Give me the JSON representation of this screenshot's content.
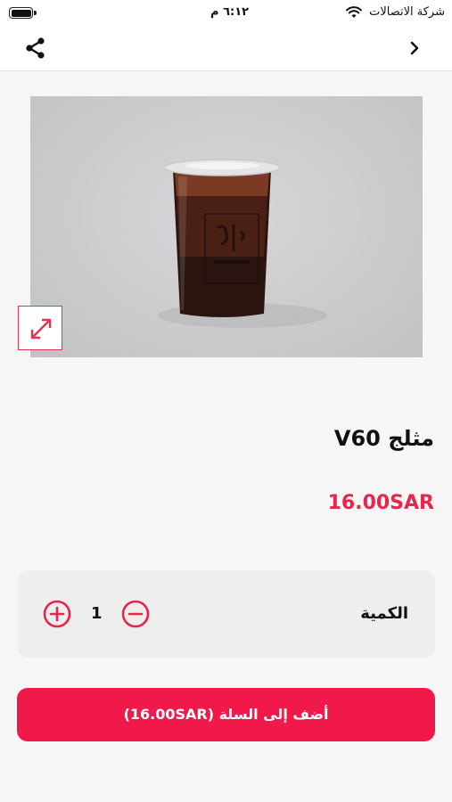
{
  "status_bar": {
    "carrier": "شركة الاتصالات",
    "time": "٦:١٢ م"
  },
  "nav": {
    "share_icon": "share-icon",
    "back_icon": "chevron-right-icon"
  },
  "product": {
    "image_icon": "iced-coffee-cup-photo",
    "expand_icon": "expand-arrows-icon",
    "name": "مثلج V60",
    "price": "16.00SAR"
  },
  "quantity": {
    "label": "الكمية",
    "value": "1",
    "plus_icon": "plus-circle-icon",
    "minus_icon": "minus-circle-icon"
  },
  "cart": {
    "add_label": "أضف إلى السلة (16.00SAR)"
  },
  "colors": {
    "accent": "#f1184a",
    "price": "#e8264b",
    "background": "#f6f6f6"
  }
}
